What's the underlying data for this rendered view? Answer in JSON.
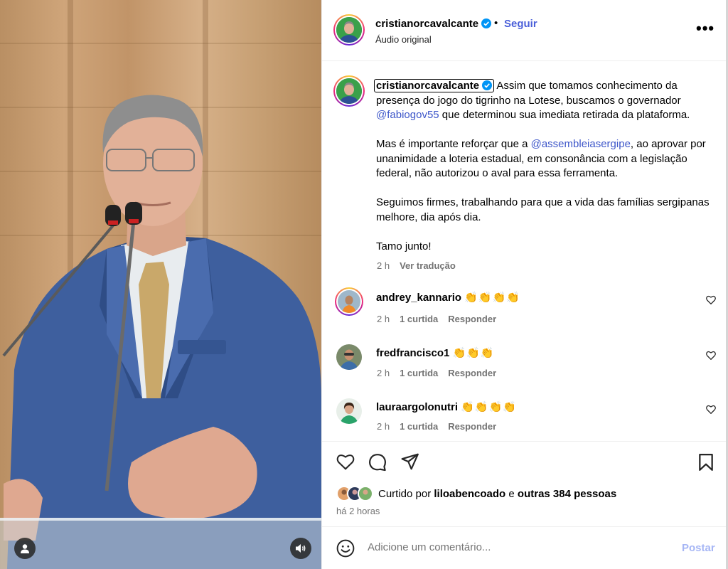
{
  "post": {
    "author": "cristianorcavalcante",
    "follow_label": "Seguir",
    "separator": "•",
    "audio_label": "Áudio original",
    "more_label": "•••",
    "caption": {
      "p1_text": " Assim que tomamos conhecimento da presença do jogo do tigrinho na Lotese, buscamos o governador ",
      "p1_mention": "@fabiogov55",
      "p1_end": " que determinou sua imediata retirada da plataforma.",
      "p2_start": "Mas é importante reforçar que a ",
      "p2_mention": "@assembleiasergipe",
      "p2_end": ", ao aprovar por unanimidade a loteria estadual, em consonância com a legislação federal, não autorizou o aval para essa ferramenta.",
      "p3": "Seguimos firmes, trabalhando para que a vida das famílias sergipanas melhore, dia após dia.",
      "p4": "Tamo junto!",
      "time": "2 h",
      "translate_label": "Ver tradução"
    },
    "comments": [
      {
        "user": "andrey_kannario",
        "text": "👏👏👏👏",
        "time": "2 h",
        "likes": "1 curtida",
        "reply_label": "Responder"
      },
      {
        "user": "fredfrancisco1",
        "text": "👏👏👏",
        "time": "2 h",
        "likes": "1 curtida",
        "reply_label": "Responder"
      },
      {
        "user": "lauraargolonutri",
        "text": "👏👏👏👏",
        "time": "2 h",
        "likes": "1 curtida",
        "reply_label": "Responder"
      }
    ],
    "liked_by": {
      "prefix": "Curtido por",
      "user": "liloabencoado",
      "conj": "e",
      "others": "outras 384 pessoas"
    },
    "posted_ago": "há 2 horas",
    "comment_box": {
      "placeholder": "Adicione um comentário...",
      "post_label": "Postar"
    }
  },
  "icons": {
    "verified": "verified-badge-icon",
    "more": "more-options-icon",
    "heart": "heart-icon",
    "comment": "comment-icon",
    "share": "share-icon",
    "save": "bookmark-icon",
    "emoji": "emoji-icon",
    "user": "user-tag-icon",
    "audio": "audio-icon"
  },
  "colors": {
    "link": "#4a5fd9",
    "mention": "#3d56c9",
    "secondary_text": "#737373",
    "post_disabled": "#a6b6f5"
  }
}
